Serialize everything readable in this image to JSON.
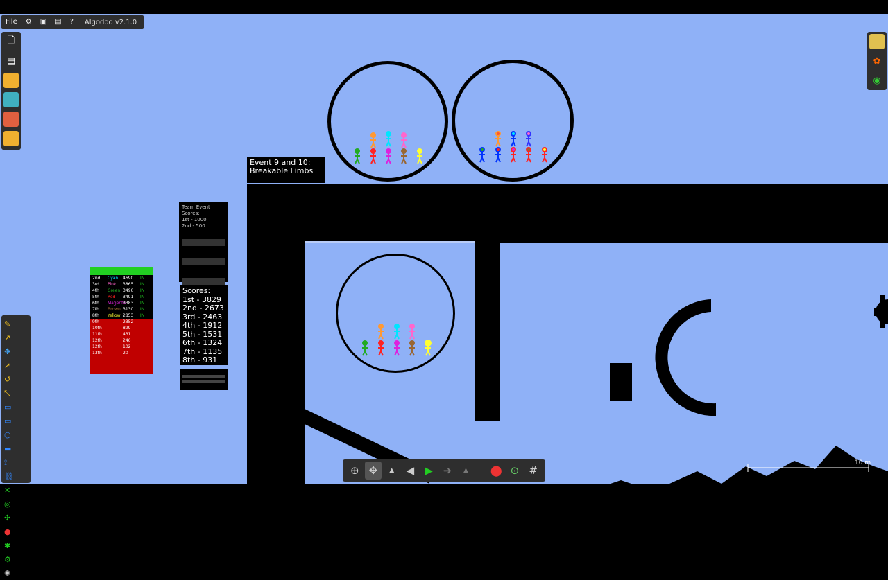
{
  "app": {
    "menu_file": "File",
    "version": "Algodoo v2.1.0"
  },
  "icons": {
    "settings": "gear-icon",
    "play_scene": "play-window-icon",
    "window": "window-icon",
    "help": "help-icon"
  },
  "event_title": {
    "line1": "Event 9 and 10:",
    "line2": "Breakable Limbs"
  },
  "team_scores": {
    "line1": "Team Event Scores:",
    "line2": "1st - 1000",
    "line3": "2nd - 500"
  },
  "scores": {
    "title": "Scores:",
    "items": [
      "1st - 3829",
      "2nd - 2673",
      "3rd - 2463",
      "4th - 1912",
      "5th - 1531",
      "6th - 1324",
      "7th - 1135",
      "8th - 931"
    ]
  },
  "leaderboard": {
    "rows": [
      {
        "rank": "2nd",
        "team": "Cyan",
        "score": "4690",
        "status": "IN",
        "color": "#00e5ff"
      },
      {
        "rank": "3rd",
        "team": "Pink",
        "score": "3865",
        "status": "IN",
        "color": "#ff66cc"
      },
      {
        "rank": "4th",
        "team": "Green",
        "score": "3496",
        "status": "IN",
        "color": "#22aa22"
      },
      {
        "rank": "5th",
        "team": "Red",
        "score": "3491",
        "status": "IN",
        "color": "#ff2222"
      },
      {
        "rank": "6th",
        "team": "Magenta",
        "score": "3383",
        "status": "IN",
        "color": "#dd22dd"
      },
      {
        "rank": "7th",
        "team": "Brown",
        "score": "3130",
        "status": "IN",
        "color": "#996633"
      },
      {
        "rank": "8th",
        "team": "Yellow",
        "score": "2853",
        "status": "IN",
        "color": "#ffff33"
      }
    ],
    "eliminated": [
      {
        "rank": "9th",
        "score": "2352"
      },
      {
        "rank": "10th",
        "score": "899"
      },
      {
        "rank": "11th",
        "score": "431"
      },
      {
        "rank": "12th",
        "score": "246"
      },
      {
        "rank": "12th",
        "score": "102"
      },
      {
        "rank": "13th",
        "score": "20"
      }
    ]
  },
  "scale": {
    "label": "10 m"
  },
  "colors": {
    "background": "#8fb1f7",
    "panel": "#2e2e2e",
    "play_green": "#22cc22"
  }
}
